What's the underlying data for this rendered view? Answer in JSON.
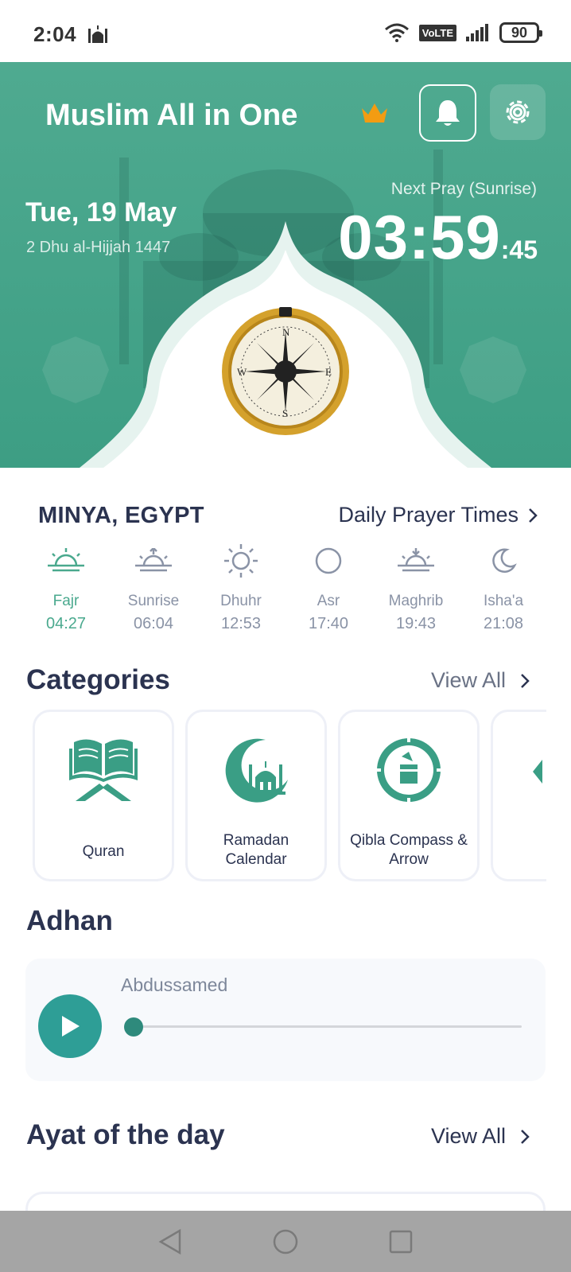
{
  "status_bar": {
    "time": "2:04",
    "volte": "VoLTE",
    "battery": "90"
  },
  "header": {
    "title": "Muslim All in One",
    "date": "Tue, 19 May",
    "hijri_date": "2 Dhu al-Hijjah 1447",
    "next_pray_label": "Next Pray (Sunrise)",
    "countdown_main": "03:59",
    "countdown_seconds": ":45",
    "compass_letters": {
      "n": "N",
      "s": "S",
      "e": "E",
      "w": "W"
    }
  },
  "prayer_section": {
    "location": "MINYA, EGYPT",
    "daily_link": "Daily Prayer Times",
    "prayers": [
      {
        "name": "Fajr",
        "time": "04:27",
        "icon": "sunrise-horizon-icon",
        "active": true
      },
      {
        "name": "Sunrise",
        "time": "06:04",
        "icon": "sunrise-arrow-icon",
        "active": false
      },
      {
        "name": "Dhuhr",
        "time": "12:53",
        "icon": "sun-icon",
        "active": false
      },
      {
        "name": "Asr",
        "time": "17:40",
        "icon": "circle-icon",
        "active": false
      },
      {
        "name": "Maghrib",
        "time": "19:43",
        "icon": "sunset-arrow-icon",
        "active": false
      },
      {
        "name": "Isha'a",
        "time": "21:08",
        "icon": "moon-icon",
        "active": false
      }
    ]
  },
  "categories": {
    "title": "Categories",
    "view_all": "View All",
    "items": [
      {
        "label": "Quran",
        "icon": "quran-icon"
      },
      {
        "label_line1": "Ramadan",
        "label_line2": "Calendar",
        "icon": "ramadan-mosque-icon"
      },
      {
        "label_line1": "Qibla Compass &",
        "label_line2": "Arrow",
        "icon": "qibla-compass-icon"
      }
    ]
  },
  "adhan": {
    "title": "Adhan",
    "reciter": "Abdussamed",
    "progress": 0
  },
  "ayat": {
    "title": "Ayat of the day",
    "view_all": "View All"
  },
  "colors": {
    "primary": "#4aa98e",
    "header_bg": "#45a389",
    "play_button": "#2e9e96",
    "text_dark": "#2b3350",
    "text_muted": "#8a93a6",
    "crown": "#f39c12"
  }
}
